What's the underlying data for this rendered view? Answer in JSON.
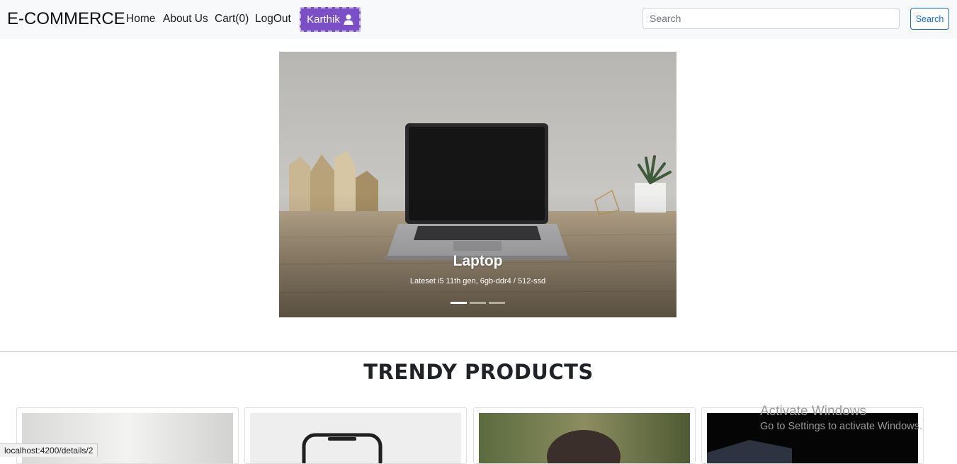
{
  "navbar": {
    "brand": "E-COMMERCE",
    "links": [
      "Home",
      "About Us",
      "Cart(0)",
      "LogOut"
    ],
    "user": {
      "name": "Karthik",
      "icon": "user-icon"
    },
    "search": {
      "placeholder": "Search",
      "value": "",
      "button_label": "Search"
    }
  },
  "carousel": {
    "slide": {
      "title": "Laptop",
      "description": "Lateset i5 11th gen, 6gb-ddr4 / 512-ssd"
    },
    "indicator_count": 3,
    "active_index": 0
  },
  "products_section": {
    "title": "TRENDY PRODUCTS",
    "cards": [
      "product-card-1",
      "product-card-2",
      "product-card-3",
      "product-card-4"
    ]
  },
  "os_watermark": {
    "line1": "Activate Windows",
    "line2": "Go to Settings to activate Windows."
  },
  "status_bar": {
    "url": "localhost:4200/details/2"
  }
}
